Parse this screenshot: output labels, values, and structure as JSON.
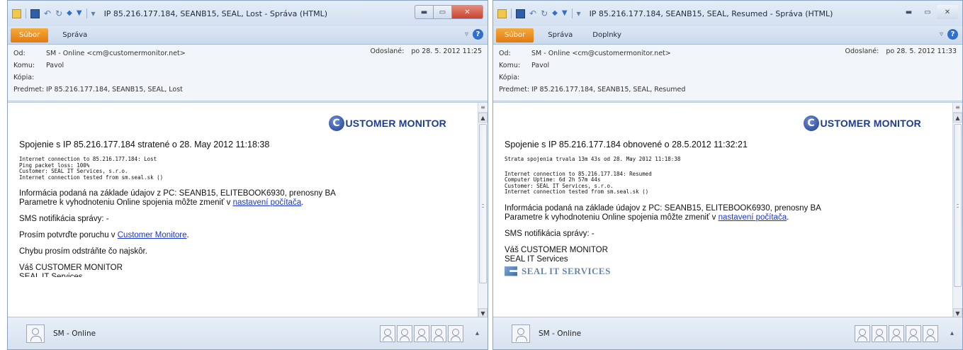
{
  "left": {
    "title": "IP 85.216.177.184, SEANB15, SEAL, Lost  -  Správa (HTML)",
    "tabs": [
      "Súbor",
      "Správa"
    ],
    "from_label": "Od:",
    "from": "SM - Online <cm@customermonitor.net>",
    "to_label": "Komu:",
    "to": "Pavol",
    "cc_label": "Kópia:",
    "cc": "",
    "subject_label": "Predmet:",
    "subject": "IP 85.216.177.184, SEANB15, SEAL, Lost",
    "sent_label": "Odoslané:",
    "sent": "po 28. 5. 2012 11:25",
    "logo_letter": "C",
    "logo_text": "USTOMER MONITOR",
    "lead": "Spojenie s IP 85.216.177.184 stratené o 28. May 2012 11:18:38",
    "mono_lines": [
      "Internet connection to 85.216.177.184: Lost",
      "Ping packet loss: 100%",
      "Customer: SEAL IT Services, s.r.o.",
      "Internet connection tested from sm.seal.sk ()"
    ],
    "info_line1": "Informácia podaná na základe údajov z PC: SEANB15, ELITEBOOK6930, prenosny BA",
    "info_line2_pre": "Parametre k vyhodnoteniu Online spojenia môžte zmeniť v ",
    "info_link": "nastavení počítača",
    "info_line2_post": ".",
    "sms": "SMS notifikácia správy: -",
    "confirm_pre": "Prosím potvrďte poruchu v ",
    "confirm_link": "Customer Monitore",
    "confirm_post": ".",
    "fix": "Chybu prosím odstráňte čo najskôr.",
    "sign1": "Váš CUSTOMER MONITOR",
    "sign2_cut": "SEAL IT Services",
    "person": "SM - Online"
  },
  "right": {
    "title": "IP 85.216.177.184, SEANB15, SEAL, Resumed  -  Správa (HTML)",
    "tabs": [
      "Súbor",
      "Správa",
      "Doplnky"
    ],
    "from_label": "Od:",
    "from": "SM - Online <cm@customermonitor.net>",
    "to_label": "Komu:",
    "to": "Pavol",
    "cc_label": "Kópia:",
    "cc": "",
    "subject_label": "Predmet:",
    "subject": "IP 85.216.177.184, SEANB15, SEAL, Resumed",
    "sent_label": "Odoslané:",
    "sent": "po 28. 5. 2012 11:33",
    "logo_letter": "C",
    "logo_text": "USTOMER MONITOR",
    "lead": "Spojenie s IP 85.216.177.184 obnovené o 28.5.2012 11:32:21",
    "outage": "Strata spojenia trvala 13m 43s od 28. May 2012 11:18:38",
    "mono_lines": [
      "Internet connection to 85.216.177.184: Resumed",
      "Computer Uptime: 6d 2h 57m 44s",
      "Customer: SEAL IT Services, s.r.o.",
      "Internet connection tested from sm.seal.sk ()"
    ],
    "info_line1": "Informácia podaná na základe údajov z PC: SEANB15, ELITEBOOK6930, prenosny BA",
    "info_line2_pre": "Parametre k vyhodnoteniu Online spojenia môžte zmeniť v ",
    "info_link": "nastavení počítača",
    "info_line2_post": ".",
    "sms": "SMS notifikácia správy: -",
    "sign1": "Váš CUSTOMER MONITOR",
    "sign2": "SEAL IT Services",
    "seal_logo": "SEAL IT SERVICES",
    "person": "SM - Online"
  }
}
